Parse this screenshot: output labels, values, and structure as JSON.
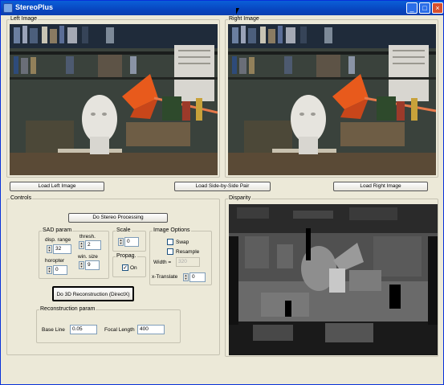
{
  "window": {
    "title": "StereoPlus",
    "controls": [
      "minimize-icon",
      "maximize-icon",
      "close-icon"
    ]
  },
  "left_image": {
    "label": "Left Image"
  },
  "right_image": {
    "label": "Right Image"
  },
  "load_buttons": {
    "left": "Load Left Image",
    "pair": "Load Side-by-Side Pair",
    "right": "Load Right Image"
  },
  "controls": {
    "label": "Controls",
    "do_stereo": "Do Stereo Processing",
    "sad": {
      "label": "SAD param",
      "disp_range_label": "disp. range",
      "disp_range_value": "32",
      "thresh_label": "thresh.",
      "thresh_value": "2",
      "horopter_label": "horopter",
      "horopter_value": "0",
      "win_size_label": "win. size",
      "win_size_value": "9"
    },
    "scale": {
      "label": "Scale",
      "value": "0"
    },
    "propag": {
      "label": "Propag.",
      "option": "On",
      "checked": true
    },
    "image_options": {
      "label": "Image Options",
      "swap": "Swap",
      "resample": "Resample",
      "width_label": "Width =",
      "width_value": "320",
      "x_translate_label": "x-Translate",
      "x_translate_value": "0"
    },
    "do_3d": "Do 3D Reconstruction (DirectX)",
    "reconstruction": {
      "label": "Reconstruction param",
      "base_line_label": "Base Line",
      "base_line_value": "0.05",
      "focal_length_label": "Focal Length",
      "focal_length_value": "400"
    }
  },
  "disparity": {
    "label": "Disparity"
  }
}
